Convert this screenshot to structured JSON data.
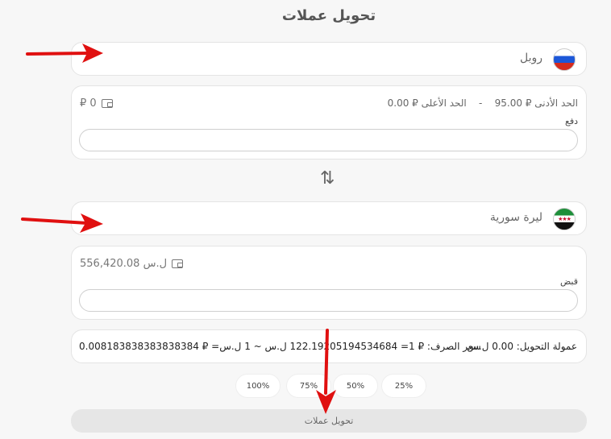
{
  "page": {
    "title": "تحويل عملات"
  },
  "from": {
    "currency": "روبل",
    "flag": "russia-flag",
    "min_label": "الحد الأدنى ₽ 95.00",
    "separator": "-",
    "max_label": "الحد الأعلى ₽ 0.00",
    "balance": "₽ 0",
    "field_label": "دفع",
    "value": ""
  },
  "to": {
    "currency": "ليرة سورية",
    "flag": "syria-flag",
    "balance": "556,420.08 ل.س",
    "field_label": "قبض",
    "value": ""
  },
  "rate": {
    "fee": "عمولة التحويل: 0.00 ل.س",
    "exchange": "سعر الصرف: ₽ 1= 122.19205194534684 ل.س ~ 1 ل.س= ₽ 0.008183838383838384"
  },
  "percent_buttons": [
    "25%",
    "50%",
    "75%",
    "100%"
  ],
  "submit_label": "تحويل عملات",
  "colors": {
    "annotation_arrow": "#e01010",
    "button_bg": "#e6e6e6"
  }
}
